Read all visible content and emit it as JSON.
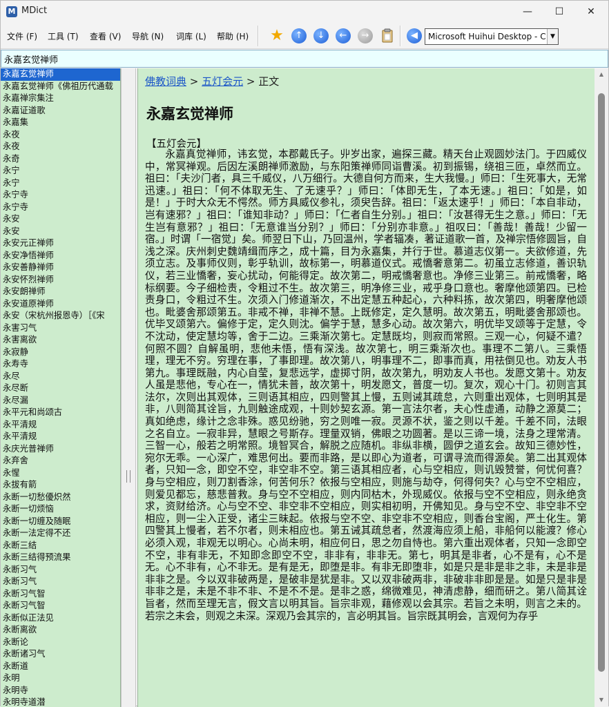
{
  "window": {
    "title": "MDict",
    "controls": {
      "minimize": "—",
      "maximize": "☐",
      "close": "✕"
    }
  },
  "menu": [
    "文件 (F)",
    "工具 (T)",
    "查看 (V)",
    "导航 (N)",
    "词库 (L)",
    "帮助 (H)"
  ],
  "toolbar": {
    "icons": [
      "star-icon",
      "arrow-up-icon",
      "arrow-down-icon",
      "arrow-left-icon",
      "arrow-right-icon",
      "clipboard-icon",
      "speaker-back-icon"
    ],
    "dictionary_selected": "Microsoft Huihui Desktop - C"
  },
  "search": {
    "value": "永嘉玄觉禅师"
  },
  "wordlist": [
    "永嘉玄觉禅师",
    "永嘉玄觉禅师《佛祖历代通载",
    "永嘉禅宗集注",
    "永嘉证道歌",
    "永嘉集",
    "永夜",
    "永夜",
    "永奇",
    "永宁",
    "永宁",
    "永宁寺",
    "永宁寺",
    "永安",
    "永安",
    "永安元正禅师",
    "永安净悟禅师",
    "永安善静禅师",
    "永安怀烈禅师",
    "永安朗禅师",
    "永安道原禅师",
    "永安（宋杭州报恩寺）［《宋",
    "永害习气",
    "永害离欲",
    "永寂静",
    "永寿寺",
    "永尽",
    "永尽断",
    "永尽漏",
    "永平元和尚颂古",
    "永平清规",
    "永平清规",
    "永庆光普禅师",
    "永弃舍",
    "永惺",
    "永拔有箭",
    "永断一切愁優炽然",
    "永断一切烦恼",
    "永断一切缠及随眠",
    "永断一法定得不还",
    "永断三结",
    "永断三结得预流果",
    "永断习气",
    "永断习气",
    "永断习气智",
    "永断习气智",
    "永断似正法见",
    "永断离欲",
    "永断论",
    "永断诸习气",
    "永断道",
    "永明",
    "永明寺",
    "永明寺道潜"
  ],
  "breadcrumb": {
    "link1": "佛教词典",
    "sep1": " > ",
    "link2": "五灯会元",
    "sep2": " > ",
    "current": "正文"
  },
  "entry": {
    "title": "永嘉玄觉禅师",
    "section": "【五灯会元】",
    "body": "永嘉真觉禅师，讳玄觉，本郡戴氏子。丱岁出家，遍探三藏。精天台止观圆妙法门。于四威仪中，常冥禅观。后因左溪朗禅师激励，与东阳策禅师同诣曹溪。初到振锡，绕祖三匝，卓然而立。祖曰：「夫沙门者，具三千威仪，八万细行。大德自何方而来，生大我慢。」师曰：「生死事大，无常迅速。」祖曰：「何不体取无生、了无速乎？」师曰：「体即无生，了本无速。」祖曰：「如是，如是！」于时大众无不愕然。师方具威仪参礼，须臾告辞。祖曰：「返太速乎！」师曰：「本自非动，岂有速邪？」祖曰：「谁知非动？」师曰：「仁者自生分别。」祖曰：「汝甚得无生之意。」师曰：「无生岂有意邪？」祖曰：「无意谁当分别？」师曰：「分别亦非意。」祖叹曰：「善哉！善哉！少留一宿。」时谓「一宿觉」矣。师翌日下山，乃回温州，学者辐凑，著证道歌一首，及禅宗悟修圆旨，自浅之深。庆州刺史魏靖缉而序之，成十篇，目为永嘉集，并行于世。慕道志仪第一。夫欲修道，先须立志。及事师仪则，彰乎轨训，故标第一，明慕道仪式。戒憍奢意第二。初虽立志修道，善识轨仪，若三业憍奢，妄心扰动，何能得定。故次第二，明戒憍奢意也。净修三业第三。前戒憍奢，略标纲要。今子细检责，令粗过不生。故次第三，明净修三业，戒乎身口意也。奢摩他颂第四。已检责身口，令粗过不生。次须入门修道渐次，不出定慧五种起心，六种料拣，故次第四，明奢摩他颂也。毗婆舍那颂第五。非戒不禅，非禅不慧。上既修定，定久慧明。故次第五，明毗婆舍那颂也。优毕叉颂第六。偏修于定，定久则沈。偏学于慧，慧多心动。故次第六，明优毕叉颂等于定慧，令不沈动，使定慧均等，舍于二边。三乘渐次第七。定慧既均，则寂而常照。三观一心，何疑不遣？何照不圆？自解虽明，悲他未悟，悟有深浅。故次第七，明三乘渐次也。事理不二第八。三乘悟理，理无不穷。穷理在事，了事即理。故次第八，明事理不二，即事而真，用祛倒见也。劝友人书第九。事理既融，内心自莹，复悲远学，虚掷寸阴，故次第九，明劝友人书也。发愿文第十。劝友人虽是悲他，专心在一，情犹未普，故次第十，明发愿文，普度一切。复次，观心十门。初则言其法尔，次则出其观体，三则语其相应，四则警其上慢，五则诫其疏怠，六则重出观体，七则明其是非，八则简其诠旨，九则触途成观，十则妙契玄源。第一言法尔者，夫心性虚通，动静之源莫二；真如绝虑，缘计之念非殊。惑见纷驰，穷之则唯一寂。灵源不状，鉴之则以千差。千差不同，法眼之名自立。一寂非异，慧眼之号斯存。理量双销，佛眼之功圆著。是以三谛一境，法身之理常清。三智一心，般若之明常照。境智冥合，解脱之应随机。非纵非横，圆伊之道玄会。故知三德妙性，宛尔无乖。一心深广，难思何出。要而非路，是以即心为道者，可谓寻流而得源矣。第二出其观体者，只知一念，即空不空，非空非不空。第三语其相应者，心与空相应，则讥毁赞誉，何忧何喜？身与空相应，则刀割香涂，何苦何乐？依报与空相应，则施与劫夺，何得何失？心与空不空相应，则爱见都忘，慈悲普救。身与空不空相应，则内同枯木，外现威仪。依报与空不空相应，则永绝贪求，资财给济。心与空不空、非空非不空相应，则实相初明，开佛知见。身与空不空、非空非不空相应，则一尘入正受，诸尘三昧起。依报与空不空、非空非不空相应，则香台宝阁，严土化生。第四警其上慢者，若不尔者，则未相应也。第五诫其疏怠者，然渡海应须上船，非船何以能渡？修心必须入观，非观无以明心。心尚未明，相应何日，思之勿自恃也。第六重出观体者，只知一念即空不空，非有非无，不知即念即空不空，非非有，非非无。第七，明其是非者，心不是有，心不是无。心不非有，心不非无。是有是无，即堕是非。有非无即堕非，如是只是非是非之非，未是非是非非之是。今以双非破两是，是破非是犹是非。又以双非破两非，非破非非即是是。如是只是非是非非之是，未是不非不非、不是不不是。是非之惑，绵微难见，神清虑静，细而研之。第八简其诠旨者，然而至理无言，假文言以明其旨。旨宗非观，藉修观以会其宗。若旨之未明，则言之未的。若宗之未会，则观之未深。深观乃会其宗的，言必明其旨。旨宗既其明会，言观何为存乎"
  }
}
